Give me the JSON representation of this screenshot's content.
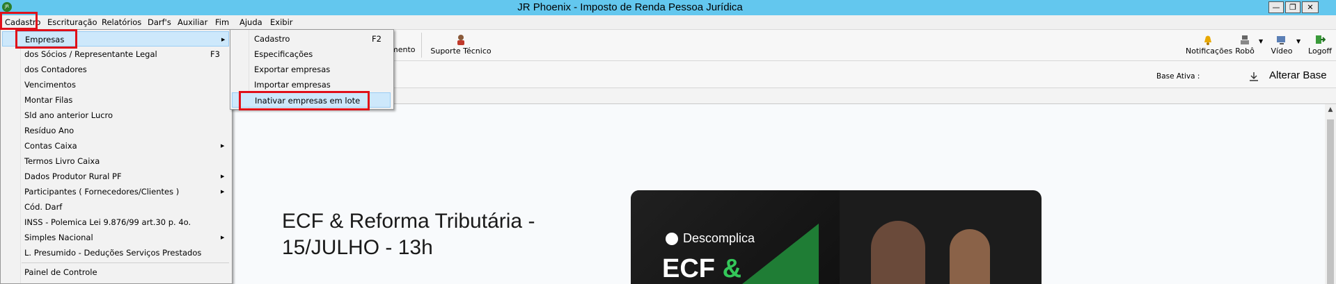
{
  "window": {
    "title": "JR Phoenix - Imposto de Renda Pessoa Jurídica",
    "app_icon_text": "JR"
  },
  "menubar": [
    "Cadastro",
    "Escrituração",
    "Relatórios",
    "Darf's",
    "Auxiliar",
    "Fim",
    "Ajuda",
    "Exibir"
  ],
  "toolbar": {
    "partial_label": "mento",
    "support_label": "Suporte Técnico",
    "notifications_label": "Notificações",
    "robot_label": "Robô",
    "video_label": "Vídeo",
    "logoff_label": "Logoff"
  },
  "basebar": {
    "base_label": "Base Ativa :",
    "change_base_label": "Alterar Base"
  },
  "cadastro_menu": {
    "items": [
      {
        "label": "Empresas",
        "shortcut": "",
        "submenu": true
      },
      {
        "label": "dos Sócios / Representante Legal",
        "shortcut": "F3",
        "submenu": false
      },
      {
        "label": "dos Contadores",
        "shortcut": "",
        "submenu": false
      },
      {
        "label": "Vencimentos",
        "shortcut": "",
        "submenu": false
      },
      {
        "label": "Montar Filas",
        "shortcut": "",
        "submenu": false
      },
      {
        "label": "Sld ano anterior Lucro",
        "shortcut": "",
        "submenu": false
      },
      {
        "label": "Resíduo Ano",
        "shortcut": "",
        "submenu": false
      },
      {
        "label": "Contas Caixa",
        "shortcut": "",
        "submenu": true
      },
      {
        "label": "Termos Livro Caixa",
        "shortcut": "",
        "submenu": false
      },
      {
        "label": "Dados Produtor Rural PF",
        "shortcut": "",
        "submenu": true
      },
      {
        "label": "Participantes ( Fornecedores/Clientes )",
        "shortcut": "",
        "submenu": true
      },
      {
        "label": "Cód. Darf",
        "shortcut": "",
        "submenu": false
      },
      {
        "label": "INSS - Polemica Lei 9.876/99 art.30  p. 4o.",
        "shortcut": "",
        "submenu": false
      },
      {
        "label": "Simples Nacional",
        "shortcut": "",
        "submenu": true
      },
      {
        "label": "L. Presumido - Deduções Serviços Prestados",
        "shortcut": "",
        "submenu": false
      },
      {
        "label": "Painel de Controle",
        "shortcut": "",
        "submenu": false
      }
    ]
  },
  "empresas_submenu": {
    "items": [
      {
        "label": "Cadastro",
        "shortcut": "F2"
      },
      {
        "label": "Especificações",
        "shortcut": ""
      },
      {
        "label": "Exportar empresas",
        "shortcut": ""
      },
      {
        "label": "Importar empresas",
        "shortcut": ""
      },
      {
        "label": "Inativar empresas em lote",
        "shortcut": ""
      }
    ]
  },
  "content": {
    "headline": "ECF & Reforma Tributária - 15/JULHO - 13h",
    "promo_brand": "Descomplica",
    "promo_title_prefix": "ECF",
    "promo_title_amp": "&"
  },
  "colors": {
    "title_bar": "#63c7ee",
    "highlight_box": "#e01019",
    "menu_highlight": "#cde8fb"
  }
}
